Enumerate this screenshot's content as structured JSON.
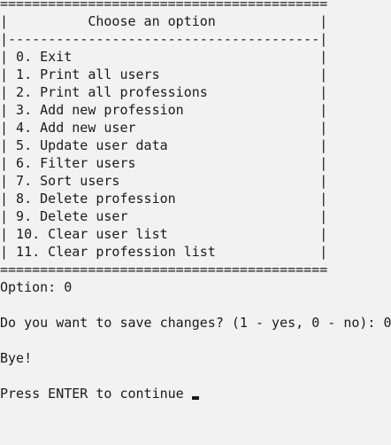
{
  "menu": {
    "border_top": "=========================================",
    "title_line": "|          Choose an option             |",
    "separator": "|---------------------------------------|",
    "items": [
      "| 0. Exit                               |",
      "| 1. Print all users                    |",
      "| 2. Print all professions              |",
      "| 3. Add new profession                 |",
      "| 4. Add new user                       |",
      "| 5. Update user data                   |",
      "| 6. Filter users                       |",
      "| 7. Sort users                         |",
      "| 8. Delete profession                  |",
      "| 9. Delete user                        |",
      "| 10. Clear user list                   |",
      "| 11. Clear profession list             |"
    ],
    "border_bottom": "========================================="
  },
  "output": {
    "option_line": "Option: 0",
    "save_prompt": "Do you want to save changes? (1 - yes, 0 - no): 0",
    "bye": "Bye!",
    "continue_prompt": "Press ENTER to continue "
  }
}
